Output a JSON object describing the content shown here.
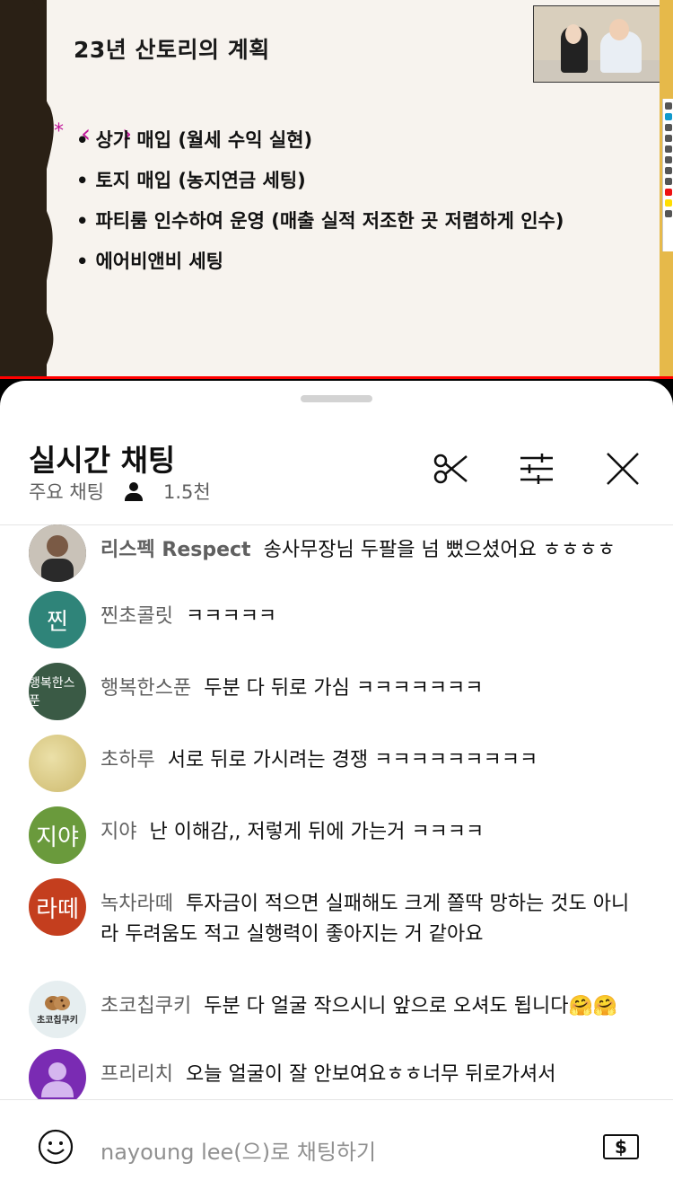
{
  "video": {
    "slide_title": "23년 산토리의 계획",
    "bullets": [
      "상가 매입 (월세 수익 실현)",
      "토지 매입 (농지연금 세팅)",
      "파티룸 인수하여 운영 (매출 실적 저조한 곳 저렴하게 인수)",
      "에어비앤비 세팅"
    ],
    "annotation_star": "*",
    "progress_color": "#ff0000"
  },
  "chat": {
    "title": "실시간 채팅",
    "mode": "주요 채팅",
    "viewer_count": "1.5천",
    "messages": [
      {
        "author": "리스펙 Respect",
        "text": "송사무장님 두팔을 넘 뻤으셨어요 ㅎㅎㅎㅎ",
        "avatar_text": "",
        "avatar_color": "#3a3a3a",
        "bold": true
      },
      {
        "author": "찐초콜릿",
        "text": "ㅋㅋㅋㅋㅋ",
        "avatar_text": "찐",
        "avatar_color": "#2f8479"
      },
      {
        "author": "행복한스푼",
        "text": "두분 다 뒤로 가심 ㅋㅋㅋㅋㅋㅋㅋ",
        "avatar_text": "행복한스푼",
        "avatar_color": "#3a5a45"
      },
      {
        "author": "초하루",
        "text": "서로 뒤로 가시려는 경쟁 ㅋㅋㅋㅋㅋㅋㅋㅋㅋ",
        "avatar_text": "",
        "avatar_color": "#dccd8a"
      },
      {
        "author": "지야",
        "text": "난 이해감,, 저렇게 뒤에 가는거 ㅋㅋㅋㅋ",
        "avatar_text": "지야",
        "avatar_color": "#6a9a3c"
      },
      {
        "author": "녹차라떼",
        "text": "투자금이 적으면 실패해도 크게 쫄딱 망하는 것도 아니라 두려움도 적고 실행력이 좋아지는 거 같아요",
        "avatar_text": "라떼",
        "avatar_color": "#c43e1e"
      },
      {
        "author": "초코칩쿠키",
        "text": "두분 다 얼굴 작으시니 앞으로 오셔도 됩니다🤗🤗",
        "avatar_text": "초코칩쿠키",
        "avatar_color": "#e6eef0"
      },
      {
        "author": "프리리치",
        "text": "오늘 얼굴이 잘 안보여요ㅎㅎ너무 뒤로가셔서",
        "avatar_text": "",
        "avatar_color": "#7a2bb3"
      }
    ],
    "input_placeholder": "nayoung lee(으)로 채팅하기",
    "superchat_icon": "$"
  },
  "icons": {
    "scissors": "scissors-icon",
    "filter": "sliders-icon",
    "close": "close-icon",
    "emoji": "emoji-icon",
    "person": "person-icon",
    "superchat": "dollar-icon"
  }
}
